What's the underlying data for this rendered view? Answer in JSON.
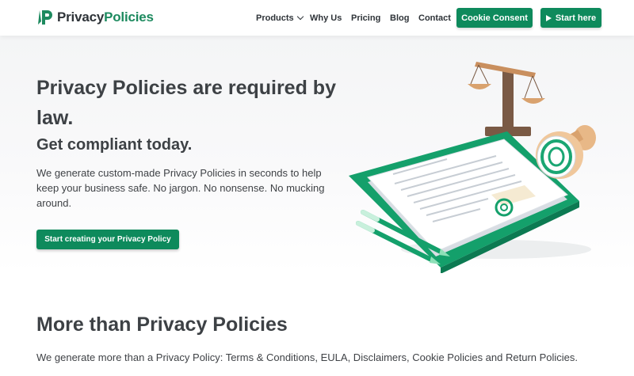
{
  "brand": {
    "name_part1": "Privacy",
    "name_part2": "Policies",
    "accent": "#1d8a5f"
  },
  "nav": {
    "items": [
      {
        "label": "Products",
        "has_dropdown": true
      },
      {
        "label": "Why Us"
      },
      {
        "label": "Pricing"
      },
      {
        "label": "Blog"
      },
      {
        "label": "Contact"
      }
    ],
    "cookie_button": "Cookie Consent",
    "start_button": "Start here"
  },
  "hero": {
    "title": "Privacy Policies are required by law.",
    "subtitle": "Get compliant today.",
    "description": "We generate custom-made Privacy Policies in seconds to help keep your business safe. No jargon. No nonsense. No mucking around.",
    "cta": "Start creating your Privacy Policy"
  },
  "section": {
    "title": "More than Privacy Policies",
    "text": "We generate more than a Privacy Policy: Terms & Conditions, EULA, Disclaimers, Cookie Policies and Return Policies."
  },
  "colors": {
    "primary": "#0e8a5c",
    "heading": "#3d4145"
  },
  "icons": {
    "logo": "shield-p-logo",
    "dropdown": "chevron-down-icon",
    "start": "play-icon"
  }
}
